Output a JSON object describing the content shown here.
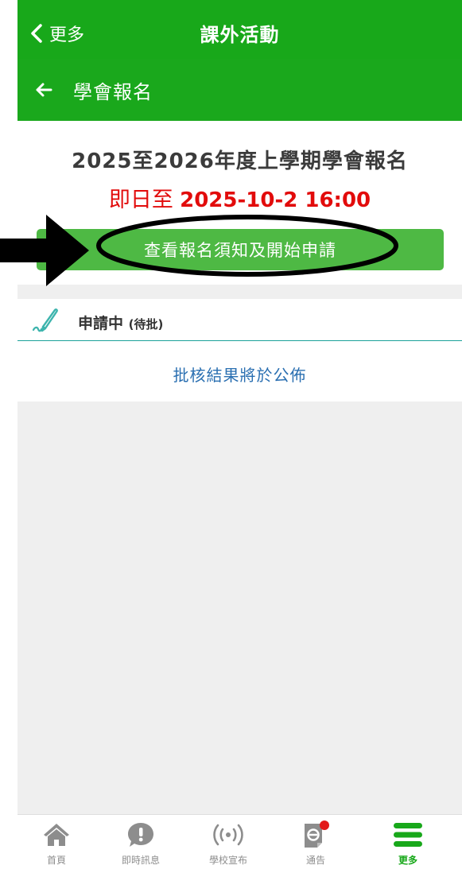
{
  "header": {
    "back_label": "更多",
    "title": "課外活動"
  },
  "subheader": {
    "title": "學會報名"
  },
  "headline": {
    "title": "2025至2026年度上學期學會報名",
    "deadline_prefix": "即日至",
    "deadline_datetime": "2025-10-2  16:00"
  },
  "apply_button": {
    "label": "查看報名須知及開始申請"
  },
  "applying": {
    "status": "申請中",
    "note": "(待批)"
  },
  "result": {
    "text": "批核結果將於公佈"
  },
  "tabbar": {
    "items": [
      {
        "label": "首頁",
        "icon": "home-icon"
      },
      {
        "label": "即時訊息",
        "icon": "message-icon"
      },
      {
        "label": "學校宣布",
        "icon": "broadcast-icon"
      },
      {
        "label": "通告",
        "icon": "notice-icon"
      },
      {
        "label": "更多",
        "icon": "menu-icon"
      }
    ],
    "active_index": 4
  },
  "colors": {
    "brand_green": "#18a81a",
    "button_green": "#4eb944",
    "deadline_red": "#e20b0b",
    "link_blue": "#2a6fb1",
    "badge_red": "#e21b1b"
  }
}
